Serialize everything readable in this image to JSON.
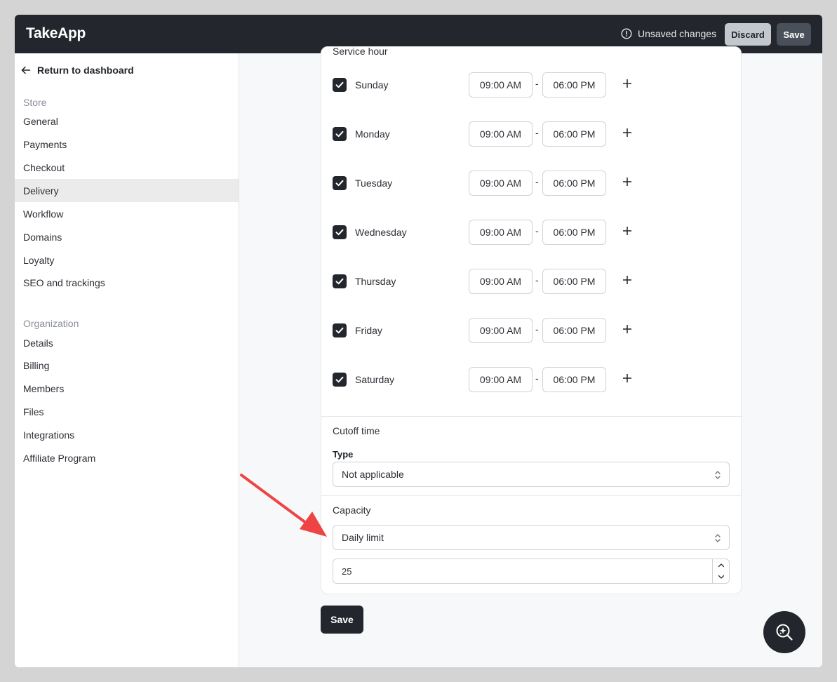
{
  "app": {
    "logo": "TakeApp",
    "unsaved_text": "Unsaved changes",
    "discard_label": "Discard",
    "save_label": "Save"
  },
  "sidebar": {
    "return_label": "Return to dashboard",
    "store_section": "Store",
    "store_items": [
      {
        "label": "General"
      },
      {
        "label": "Payments"
      },
      {
        "label": "Checkout"
      },
      {
        "label": "Delivery",
        "active": true
      },
      {
        "label": "Workflow"
      },
      {
        "label": "Domains"
      },
      {
        "label": "Loyalty"
      },
      {
        "label": "SEO and trackings"
      }
    ],
    "org_section": "Organization",
    "org_items": [
      {
        "label": "Details"
      },
      {
        "label": "Billing"
      },
      {
        "label": "Members"
      },
      {
        "label": "Files"
      },
      {
        "label": "Integrations"
      },
      {
        "label": "Affiliate Program"
      }
    ]
  },
  "service_hour": {
    "heading": "Service hour",
    "separator": "-",
    "days": [
      {
        "name": "Sunday",
        "checked": true,
        "start": "09:00 AM",
        "end": "06:00 PM"
      },
      {
        "name": "Monday",
        "checked": true,
        "start": "09:00 AM",
        "end": "06:00 PM"
      },
      {
        "name": "Tuesday",
        "checked": true,
        "start": "09:00 AM",
        "end": "06:00 PM"
      },
      {
        "name": "Wednesday",
        "checked": true,
        "start": "09:00 AM",
        "end": "06:00 PM"
      },
      {
        "name": "Thursday",
        "checked": true,
        "start": "09:00 AM",
        "end": "06:00 PM"
      },
      {
        "name": "Friday",
        "checked": true,
        "start": "09:00 AM",
        "end": "06:00 PM"
      },
      {
        "name": "Saturday",
        "checked": true,
        "start": "09:00 AM",
        "end": "06:00 PM"
      }
    ]
  },
  "cutoff": {
    "heading": "Cutoff time",
    "type_label": "Type",
    "type_value": "Not applicable"
  },
  "capacity": {
    "heading": "Capacity",
    "limit_value": "Daily limit",
    "quantity": "25"
  },
  "form": {
    "save_label": "Save"
  },
  "colors": {
    "topbar": "#23272d",
    "accent_dark": "#23272d",
    "annotation_arrow": "#ef4444"
  },
  "icons": {
    "warning": "alert-circle-icon",
    "back": "arrow-left-icon",
    "check": "check-icon",
    "plus": "plus-icon",
    "select": "chevron-up-down-icon",
    "fab": "sparkle-search-icon"
  }
}
